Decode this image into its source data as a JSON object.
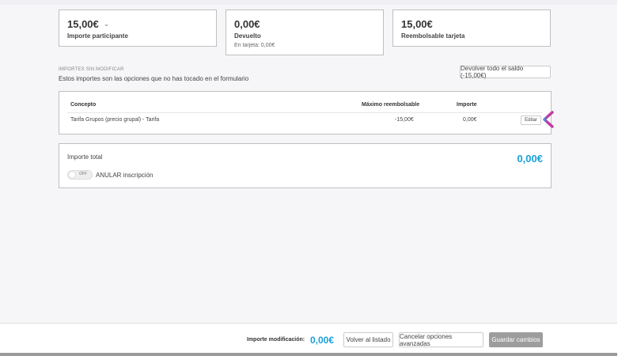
{
  "cards": [
    {
      "amount": "15,00€",
      "label": "Importe participante",
      "sub": ""
    },
    {
      "amount": "0,00€",
      "label": "Devuelto",
      "sub": "En tarjeta: 0,00€"
    },
    {
      "amount": "15,00€",
      "label": "Reembolsable tarjeta",
      "sub": ""
    }
  ],
  "section": {
    "title": "IMPORTES SIN MODIFICAR",
    "description": "Estos importes son las opciones que no has tocado en el formulario",
    "refund_all_label": "Devolver todo el saldo (-15,00€)"
  },
  "table": {
    "headers": {
      "concept": "Concepto",
      "max": "Máximo reembolsable",
      "amount": "Importe"
    },
    "rows": [
      {
        "concept": "Tarifa Grupos (precio grupal) - Tarifa",
        "max": "-15,00€",
        "amount": "0,00€",
        "edit_label": "Editar"
      }
    ]
  },
  "total": {
    "label": "Importe total",
    "value": "0,00€",
    "toggle_state": "OFF",
    "toggle_label": "ANULAR inscripción"
  },
  "footer": {
    "label": "Importe modificación:",
    "value": "0,00€",
    "back_label": "Volver al listado",
    "cancel_label": "Cancelar opciones avanzadas",
    "save_label": "Guardar cambios"
  },
  "colors": {
    "accent": "#1aa0d8",
    "arrow_start": "#4a8de0",
    "arrow_end": "#c03aa0"
  }
}
